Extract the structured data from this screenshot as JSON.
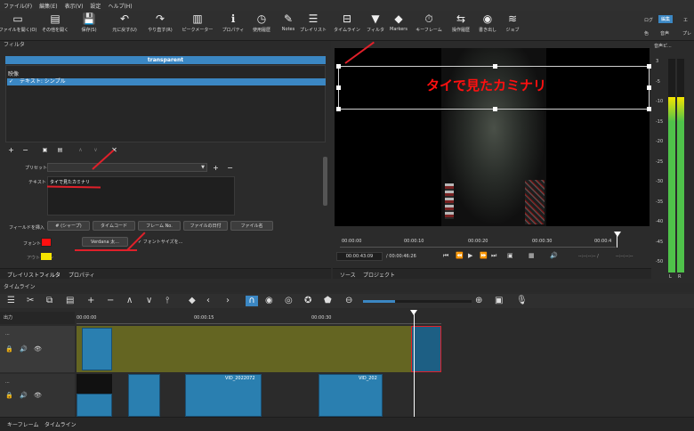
{
  "menu": [
    "ファイル(F)",
    "編集(E)",
    "表示(V)",
    "設定",
    "ヘルプ(H)"
  ],
  "toolbar": {
    "items": [
      {
        "label": "ファイルを開く(O)",
        "icon": "folder-icon",
        "glyph": "▭"
      },
      {
        "label": "その他を開く",
        "icon": "open-other-icon",
        "glyph": "▤"
      },
      {
        "label": "保存(S)",
        "icon": "save-icon",
        "glyph": "💾"
      },
      {
        "label": "元に戻す(U)",
        "icon": "undo-icon",
        "glyph": "↶"
      },
      {
        "label": "やり直す(R)",
        "icon": "redo-icon",
        "glyph": "↷"
      },
      {
        "label": "ピークメーター",
        "icon": "peak-meter-icon",
        "glyph": "▥"
      },
      {
        "label": "プロパティ",
        "icon": "info-icon",
        "glyph": "ℹ"
      },
      {
        "label": "使用履歴",
        "icon": "history-icon",
        "glyph": "◷"
      },
      {
        "label": "Notes",
        "icon": "notes-icon",
        "glyph": "✎"
      },
      {
        "label": "プレイリスト",
        "icon": "playlist-icon",
        "glyph": "☰"
      },
      {
        "label": "タイムライン",
        "icon": "timeline-icon",
        "glyph": "⊟"
      },
      {
        "label": "フィルタ",
        "icon": "filter-icon",
        "glyph": "▼"
      },
      {
        "label": "Markers",
        "icon": "markers-icon",
        "glyph": "◆"
      },
      {
        "label": "キーフレーム",
        "icon": "keyframe-icon",
        "glyph": "⏱"
      },
      {
        "label": "操作履歴",
        "icon": "job-history-icon",
        "glyph": "⇆"
      },
      {
        "label": "書き出し",
        "icon": "export-icon",
        "glyph": "◉"
      },
      {
        "label": "ジョブ",
        "icon": "jobs-icon",
        "glyph": "≋"
      }
    ],
    "right_top": [
      "ログ",
      "編集",
      "エ"
    ],
    "right_bottom": [
      "色",
      "音声",
      "プレ"
    ]
  },
  "filters": {
    "title": "フィルタ",
    "banner": "transparent",
    "group": "映像",
    "item": "テキスト: シンプル",
    "check": "✓",
    "preset_label": "プリセット",
    "text_label": "テキスト",
    "text_value": "タイで見たカミナリ",
    "insert_label": "フィールドを挿入",
    "insert_buttons": [
      "# (シャープ)",
      "タイムコード",
      "フレーム No.",
      "ファイルの日付",
      "ファイル名"
    ],
    "font_label": "フォント",
    "font_button": "Verdana 太...",
    "font_size_check": "フォントサイズを...",
    "outline_label": "アウトライン"
  },
  "bottom_tabs_left": [
    "プレイリスト",
    "フィルタ",
    "プロパティ"
  ],
  "preview": {
    "overlay_text": "タイで見たカミナリ",
    "ruler": [
      "00:00:00",
      "00:00:10",
      "00:00:20",
      "00:00:30",
      "00:00:4"
    ],
    "current_time": "00:00:43:09",
    "total_time": "/ 00:00:46:26",
    "tc_in": "--:--:--:-- /",
    "tc_out": "--:--:--:--",
    "tabs": [
      "ソース",
      "プロジェクト"
    ]
  },
  "audio_meter": {
    "title": "音声ピ...",
    "ticks": [
      "3",
      "-5",
      "-10",
      "-15",
      "-20",
      "-25",
      "-30",
      "-35",
      "-40",
      "-45",
      "-50"
    ],
    "left": "L",
    "right": "R",
    "level_fraction": 0.82
  },
  "timeline": {
    "title": "タイムライン",
    "output_label": "出力",
    "ruler": [
      "00:00:00",
      "00:00:15",
      "00:00:30"
    ],
    "track_labels": [
      "...",
      "..."
    ],
    "clips": [
      "VID_2022072",
      "VID_202"
    ]
  },
  "bottom_tabs": [
    "キーフレーム",
    "タイムライン"
  ],
  "colors": {
    "accent": "#3b87c3",
    "font_swatch": "#ff1010",
    "outline_swatch": "#f5e400",
    "annotation": "#e0202a",
    "track": "#646522",
    "clip": "#2a7fb0"
  }
}
